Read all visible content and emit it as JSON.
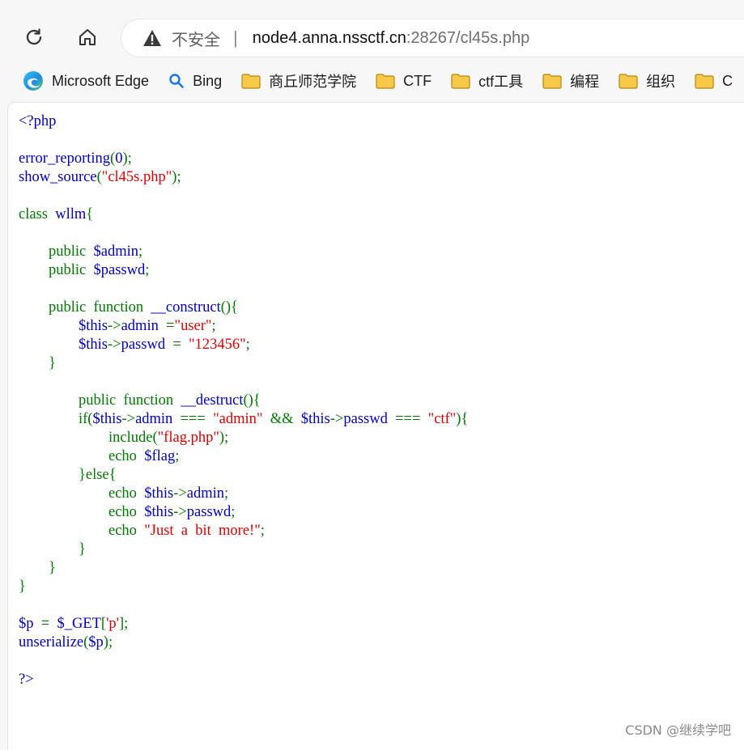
{
  "browser": {
    "security_label": "不安全",
    "url_host": "node4.anna.nssctf.cn",
    "url_path": ":28267/cl45s.php",
    "separator": "|"
  },
  "bookmarks": [
    {
      "label": "Microsoft Edge",
      "icon": "edge-logo-icon"
    },
    {
      "label": "Bing",
      "icon": "search-icon"
    },
    {
      "label": "商丘师范学院",
      "icon": "folder-icon"
    },
    {
      "label": "CTF",
      "icon": "folder-icon"
    },
    {
      "label": "ctf工具",
      "icon": "folder-icon"
    },
    {
      "label": "编程",
      "icon": "folder-icon"
    },
    {
      "label": "组织",
      "icon": "folder-icon"
    },
    {
      "label": "C",
      "icon": "folder-icon"
    }
  ],
  "code_lines": [
    [
      [
        "d",
        "<?php"
      ]
    ],
    [],
    [
      [
        "d",
        "error_reporting"
      ],
      [
        "k",
        "("
      ],
      [
        "d",
        "0"
      ],
      [
        "k",
        ");"
      ]
    ],
    [
      [
        "d",
        "show_source"
      ],
      [
        "k",
        "("
      ],
      [
        "s",
        "\"cl45s.php\""
      ],
      [
        "k",
        ");"
      ]
    ],
    [],
    [
      [
        "k",
        "class  "
      ],
      [
        "d",
        "wllm"
      ],
      [
        "k",
        "{"
      ]
    ],
    [],
    [
      [
        "k",
        "        public  "
      ],
      [
        "d",
        "$admin"
      ],
      [
        "k",
        ";"
      ]
    ],
    [
      [
        "k",
        "        public  "
      ],
      [
        "d",
        "$passwd"
      ],
      [
        "k",
        ";"
      ]
    ],
    [],
    [
      [
        "k",
        "        public  function  "
      ],
      [
        "d",
        "__construct"
      ],
      [
        "k",
        "(){"
      ]
    ],
    [
      [
        "d",
        "                $this"
      ],
      [
        "k",
        "->"
      ],
      [
        "d",
        "admin  "
      ],
      [
        "k",
        "="
      ],
      [
        "s",
        "\"user\""
      ],
      [
        "k",
        ";"
      ]
    ],
    [
      [
        "d",
        "                $this"
      ],
      [
        "k",
        "->"
      ],
      [
        "d",
        "passwd  "
      ],
      [
        "k",
        "=  "
      ],
      [
        "s",
        "\"123456\""
      ],
      [
        "k",
        ";"
      ]
    ],
    [
      [
        "k",
        "        }"
      ]
    ],
    [],
    [
      [
        "k",
        "                public  function  "
      ],
      [
        "d",
        "__destruct"
      ],
      [
        "k",
        "(){"
      ]
    ],
    [
      [
        "k",
        "                if("
      ],
      [
        "d",
        "$this"
      ],
      [
        "k",
        "->"
      ],
      [
        "d",
        "admin  "
      ],
      [
        "k",
        "===  "
      ],
      [
        "s",
        "\"admin\"  "
      ],
      [
        "k",
        "&&  "
      ],
      [
        "d",
        "$this"
      ],
      [
        "k",
        "->"
      ],
      [
        "d",
        "passwd  "
      ],
      [
        "k",
        "===  "
      ],
      [
        "s",
        "\"ctf\""
      ],
      [
        "k",
        "){"
      ]
    ],
    [
      [
        "k",
        "                        include("
      ],
      [
        "s",
        "\"flag.php\""
      ],
      [
        "k",
        ");"
      ]
    ],
    [
      [
        "k",
        "                        echo  "
      ],
      [
        "d",
        "$flag"
      ],
      [
        "k",
        ";"
      ]
    ],
    [
      [
        "k",
        "                }else{"
      ]
    ],
    [
      [
        "k",
        "                        echo  "
      ],
      [
        "d",
        "$this"
      ],
      [
        "k",
        "->"
      ],
      [
        "d",
        "admin"
      ],
      [
        "k",
        ";"
      ]
    ],
    [
      [
        "k",
        "                        echo  "
      ],
      [
        "d",
        "$this"
      ],
      [
        "k",
        "->"
      ],
      [
        "d",
        "passwd"
      ],
      [
        "k",
        ";"
      ]
    ],
    [
      [
        "k",
        "                        echo  "
      ],
      [
        "s",
        "\"Just  a  bit  more!\""
      ],
      [
        "k",
        ";"
      ]
    ],
    [
      [
        "k",
        "                }"
      ]
    ],
    [
      [
        "k",
        "        }"
      ]
    ],
    [
      [
        "k",
        "}"
      ]
    ],
    [],
    [
      [
        "d",
        "$p  "
      ],
      [
        "k",
        "=  "
      ],
      [
        "d",
        "$_GET"
      ],
      [
        "k",
        "["
      ],
      [
        "s",
        "'p'"
      ],
      [
        "k",
        "];"
      ]
    ],
    [
      [
        "d",
        "unserialize"
      ],
      [
        "k",
        "("
      ],
      [
        "d",
        "$p"
      ],
      [
        "k",
        ");"
      ]
    ],
    [],
    [
      [
        "d",
        "?>"
      ]
    ]
  ],
  "watermark": "CSDN @继续学吧",
  "colors": {
    "php_default": "#0000bb",
    "php_keyword": "#007700",
    "php_string": "#dd0000"
  }
}
